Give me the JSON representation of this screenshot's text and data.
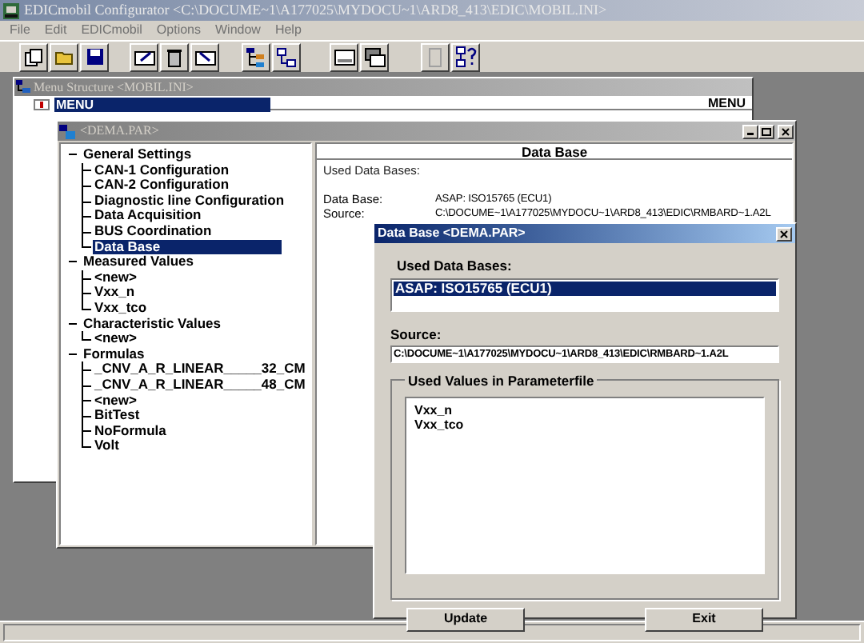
{
  "window": {
    "title": "EDICmobil Configurator <C:\\DOCUME~1\\A177025\\MYDOCU~1\\ARD8_413\\EDIC\\MOBIL.INI>"
  },
  "menu_bar": [
    "File",
    "Edit",
    "EDICmobil",
    "Options",
    "Window",
    "Help"
  ],
  "menu_structure": {
    "title": "Menu Structure <MOBIL.INI>",
    "items": [
      {
        "label": "MENU",
        "selected": true
      }
    ],
    "header": "MENU"
  },
  "par_window": {
    "title": "<DEMA.PAR>",
    "tree": [
      {
        "label": "General Settings",
        "expanded": true,
        "selected": false,
        "children": [
          {
            "label": "CAN-1 Configuration",
            "selected": false
          },
          {
            "label": "CAN-2 Configuration",
            "selected": false
          },
          {
            "label": "Diagnostic line Configuration",
            "selected": false
          },
          {
            "label": "Data Acquisition",
            "selected": false
          },
          {
            "label": "BUS Coordination",
            "selected": false
          },
          {
            "label": "Data Base",
            "selected": true
          }
        ]
      },
      {
        "label": "Measured Values",
        "expanded": true,
        "selected": false,
        "children": [
          {
            "label": "<new>",
            "selected": false
          },
          {
            "label": "Vxx_n",
            "selected": false
          },
          {
            "label": "Vxx_tco",
            "selected": false
          }
        ]
      },
      {
        "label": "Characteristic Values",
        "expanded": true,
        "selected": false,
        "children": [
          {
            "label": "<new>",
            "selected": false
          }
        ]
      },
      {
        "label": "Formulas",
        "expanded": true,
        "selected": false,
        "children": [
          {
            "label": "_CNV_A_R_LINEAR_____32_CM",
            "selected": false
          },
          {
            "label": "_CNV_A_R_LINEAR_____48_CM",
            "selected": false
          },
          {
            "label": "<new>",
            "selected": false
          },
          {
            "label": "BitTest",
            "selected": false
          },
          {
            "label": "NoFormula",
            "selected": false
          },
          {
            "label": "Volt",
            "selected": false
          }
        ]
      }
    ],
    "panel": {
      "header": "Data Base",
      "used_label": "Used Data Bases:",
      "fields": [
        {
          "label": "Data Base:",
          "value": "ASAP: ISO15765 (ECU1)"
        },
        {
          "label": "Source:",
          "value": "C:\\DOCUME~1\\A177025\\MYDOCU~1\\ARD8_413\\EDIC\\RMBARD~1.A2L"
        }
      ]
    }
  },
  "dialog": {
    "title": "Data Base <DEMA.PAR>",
    "used_label": "Used Data Bases:",
    "databases": [
      {
        "label": "ASAP: ISO15765 (ECU1)",
        "selected": true
      }
    ],
    "source_label": "Source:",
    "source_value": "C:\\DOCUME~1\\A177025\\MYDOCU~1\\ARD8_413\\EDIC\\RMBARD~1.A2L",
    "group_title": "Used Values in Parameterfile",
    "values": [
      "Vxx_n",
      "Vxx_tco"
    ],
    "buttons": [
      "Update",
      "Exit"
    ]
  }
}
